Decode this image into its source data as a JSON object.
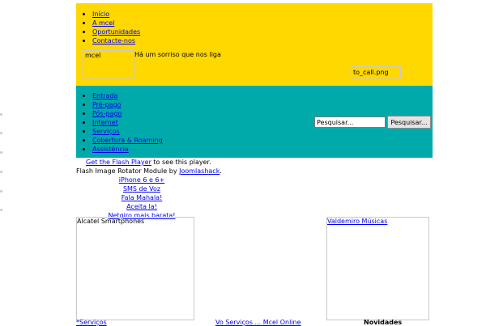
{
  "top_nav": {
    "items": [
      "Início",
      "A mcel",
      "Oportunidades",
      "Contacte-nos"
    ]
  },
  "header": {
    "logo_alt": "mcel",
    "tagline": "Há um sorriso que nos liga",
    "call_image_alt": "to_call.png"
  },
  "main_nav": {
    "items": [
      "Entrada",
      "Pré-pago",
      "Pós-pago",
      "Internet",
      "Serviços",
      "Cobertura & Roaming",
      "Assistência"
    ]
  },
  "search": {
    "placeholder": "Pesquisar...",
    "button_label": "Pesquisar..."
  },
  "flash": {
    "link_text": "Get the Flash Player",
    "after_link_text": "to see this player.",
    "module_text": "Flash Image Rotator Module by",
    "module_link": "Joomlashack",
    "module_period": "."
  },
  "rotator_links": [
    "iPhone 6 e 6+",
    "SMS de Voz",
    "Fala Mahala!",
    "Aceita la!",
    "Netgiro mais barata!"
  ],
  "modules": {
    "left_title": "Alcatel Smartphones",
    "right_title": "Valdemiro Músicas"
  },
  "bottom": {
    "left_link": "*Serviços",
    "middle_link": "Vo Serviços ... Mcel Online",
    "right_label": "Novidades"
  },
  "colors": {
    "top_band": "#ffd800",
    "nav_band": "#00aaaa",
    "link": "#0000ee"
  }
}
